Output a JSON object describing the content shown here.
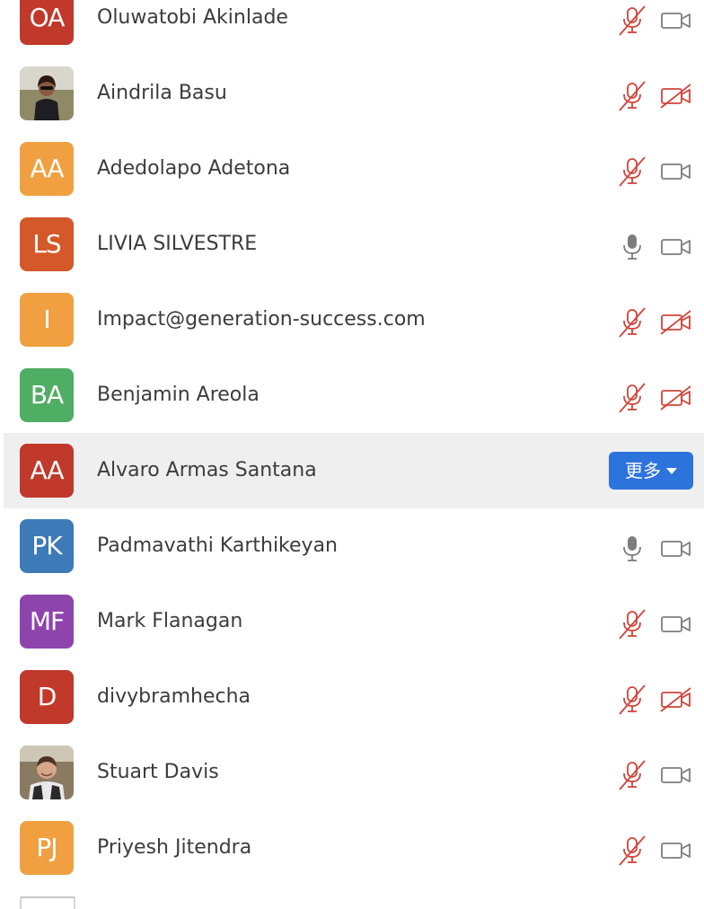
{
  "participants": [
    {
      "name": "Oluwatobi Akinlade",
      "initials": "OA",
      "avatar_color": "#c0392b",
      "avatar_type": "initials",
      "mic": "muted",
      "camera": "on"
    },
    {
      "name": "Aindrila Basu",
      "initials": "",
      "avatar_color": "",
      "avatar_type": "photo",
      "mic": "muted",
      "camera": "off"
    },
    {
      "name": "Adedolapo Adetona",
      "initials": "AA",
      "avatar_color": "#f0a040",
      "avatar_type": "initials",
      "mic": "muted",
      "camera": "on"
    },
    {
      "name": "LIVIA SILVESTRE",
      "initials": "LS",
      "avatar_color": "#d4592a",
      "avatar_type": "initials",
      "mic": "on",
      "camera": "on"
    },
    {
      "name": "Impact@generation-success.com",
      "initials": "I",
      "avatar_color": "#f0a040",
      "avatar_type": "initials",
      "mic": "muted",
      "camera": "off"
    },
    {
      "name": "Benjamin Areola",
      "initials": "BA",
      "avatar_color": "#4fad64",
      "avatar_type": "initials",
      "mic": "muted",
      "camera": "off"
    },
    {
      "name": "Alvaro Armas Santana",
      "initials": "AA",
      "avatar_color": "#c0392b",
      "avatar_type": "initials",
      "mic": "none",
      "camera": "none",
      "highlighted": true,
      "more_label": "更多"
    },
    {
      "name": "Padmavathi Karthikeyan",
      "initials": "PK",
      "avatar_color": "#3d7ab8",
      "avatar_type": "initials",
      "mic": "on",
      "camera": "on"
    },
    {
      "name": "Mark Flanagan",
      "initials": "MF",
      "avatar_color": "#8e44ad",
      "avatar_type": "initials",
      "mic": "muted",
      "camera": "on"
    },
    {
      "name": "divybramhecha",
      "initials": "D",
      "avatar_color": "#c0392b",
      "avatar_type": "initials",
      "mic": "muted",
      "camera": "off"
    },
    {
      "name": "Stuart Davis",
      "initials": "",
      "avatar_color": "",
      "avatar_type": "photo",
      "mic": "muted",
      "camera": "on"
    },
    {
      "name": "Priyesh Jitendra",
      "initials": "PJ",
      "avatar_color": "#f0a040",
      "avatar_type": "initials",
      "mic": "muted",
      "camera": "on"
    }
  ],
  "colors": {
    "muted_red": "#d0453b",
    "icon_gray": "#7d7d7d",
    "more_button_blue": "#2d73dc",
    "highlight_bg": "#efefef"
  },
  "icons": {
    "mic_on": "microphone-icon",
    "mic_muted": "microphone-muted-icon",
    "cam_on": "video-camera-icon",
    "cam_off": "video-camera-off-icon",
    "more_caret": "caret-down-icon"
  }
}
